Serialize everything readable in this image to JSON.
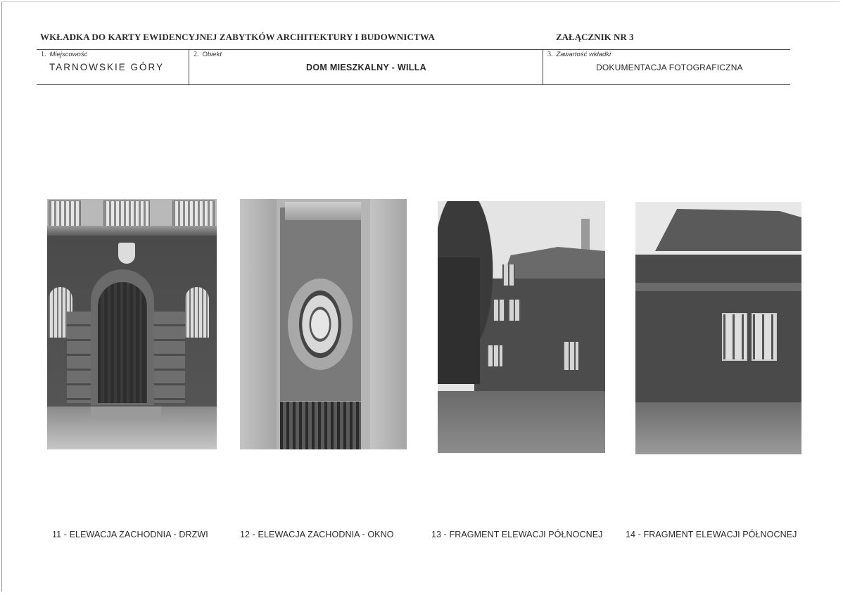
{
  "header": {
    "title": "WKŁADKA DO KARTY EWIDENCYJNEJ ZABYTKÓW ARCHITEKTURY I BUDOWNICTWA",
    "annex": "ZAŁĄCZNIK NR 3"
  },
  "fields": [
    {
      "number": "1.",
      "label": "Miejscowość",
      "value": "TARNOWSKIE GÓRY"
    },
    {
      "number": "2.",
      "label": "Obiekt",
      "value": "DOM MIESZKALNY - WILLA"
    },
    {
      "number": "3.",
      "label": "Zawartość wkładki",
      "value": "DOKUMENTACJA FOTOGRAFICZNA"
    }
  ],
  "photos": [
    {
      "caption": "11 - ELEWACJA ZACHODNIA - DRZWI"
    },
    {
      "caption": "12 - ELEWACJA ZACHODNIA - OKNO"
    },
    {
      "caption": "13 - FRAGMENT ELEWACJI PÓŁNOCNEJ"
    },
    {
      "caption": "14 - FRAGMENT ELEWACJI PÓŁNOCNEJ"
    }
  ]
}
